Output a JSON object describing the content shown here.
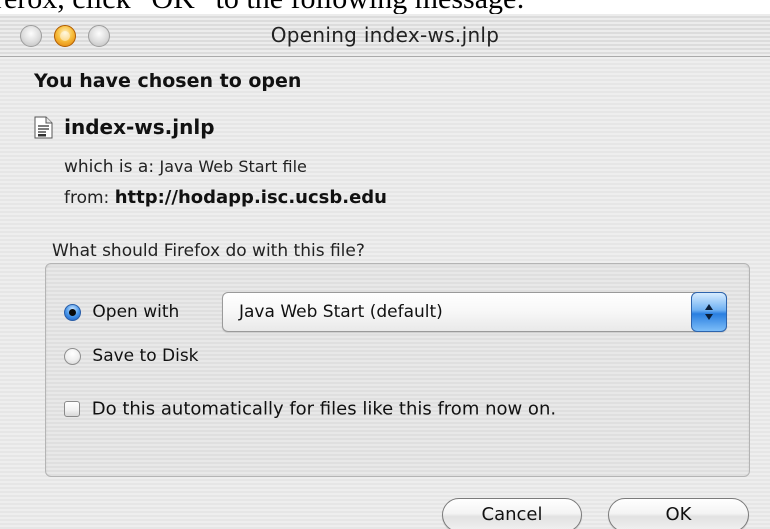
{
  "background_text": "rerox, click “OK” to the following message:",
  "window": {
    "title": "Opening index-ws.jnlp",
    "controls": [
      "close-icon",
      "minimize-icon",
      "zoom-icon"
    ]
  },
  "dialog": {
    "heading": "You have chosen to open",
    "file": {
      "name": "index-ws.jnlp",
      "icon": "document-icon"
    },
    "type_label": "which is a:",
    "type_value": "Java Web Start file",
    "from_label": "from:",
    "from_value": "http://hodapp.isc.ucsb.edu",
    "question": "What should Firefox do with this file?",
    "options": {
      "open_with_label": "Open with",
      "open_with_value": "Java Web Start (default)",
      "save_label": "Save to Disk",
      "selected": "open_with"
    },
    "auto_checkbox_label": "Do this automatically for files like this from now on.",
    "auto_checked": false,
    "buttons": {
      "cancel": "Cancel",
      "ok": "OK"
    }
  },
  "colors": {
    "accent": "#3a8de8",
    "minimize": "#f3a21c"
  }
}
